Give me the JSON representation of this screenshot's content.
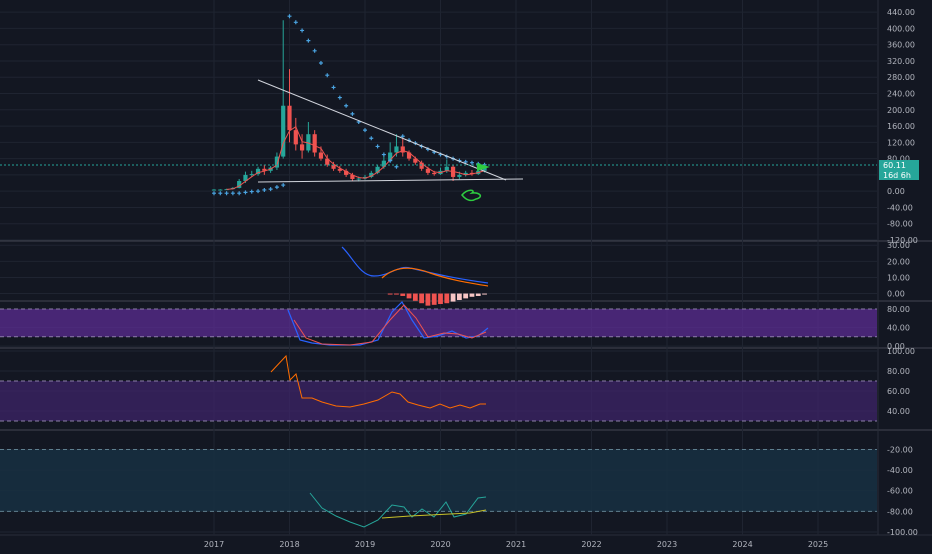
{
  "colors": {
    "bg": "#131722",
    "grid": "#1f2431",
    "axis_text": "#b2b5be",
    "up": "#26a69a",
    "down": "#ef5350",
    "sar": "#4aa3e0",
    "trend": "#d1d4dc",
    "last_badge": "#26a69a",
    "blue_line": "#2962ff",
    "orange_line": "#ff6d00",
    "band": "#4a2a7a",
    "wr_band": "#173042",
    "marker": "#2ecc40"
  },
  "x_axis": {
    "labels": [
      "2017",
      "2018",
      "2019",
      "2020",
      "2021",
      "2022",
      "2023",
      "2024",
      "2025"
    ]
  },
  "badges": {
    "last_price": "60.11",
    "countdown": "16d 6h"
  },
  "chart_data": [
    {
      "type": "candlestick",
      "pane": "price",
      "x": [
        "2017-01",
        "2017-02",
        "2017-03",
        "2017-04",
        "2017-05",
        "2017-06",
        "2017-07",
        "2017-08",
        "2017-09",
        "2017-10",
        "2017-11",
        "2017-12",
        "2018-01",
        "2018-02",
        "2018-03",
        "2018-04",
        "2018-05",
        "2018-06",
        "2018-07",
        "2018-08",
        "2018-09",
        "2018-10",
        "2018-11",
        "2018-12",
        "2019-01",
        "2019-02",
        "2019-03",
        "2019-04",
        "2019-05",
        "2019-06",
        "2019-07",
        "2019-08",
        "2019-09",
        "2019-10",
        "2019-11",
        "2019-12",
        "2020-01",
        "2020-02",
        "2020-03",
        "2020-04",
        "2020-05",
        "2020-06",
        "2020-07",
        "2020-08"
      ],
      "open": [
        4,
        4,
        4,
        5,
        8,
        25,
        40,
        42,
        55,
        50,
        58,
        85,
        210,
        150,
        115,
        100,
        140,
        95,
        80,
        65,
        55,
        50,
        40,
        30,
        31,
        35,
        45,
        60,
        75,
        95,
        110,
        95,
        80,
        70,
        55,
        45,
        42,
        50,
        60,
        35,
        40,
        45,
        42,
        50
      ],
      "close": [
        4,
        4,
        5,
        8,
        25,
        40,
        42,
        55,
        50,
        58,
        85,
        210,
        150,
        115,
        100,
        140,
        95,
        80,
        65,
        55,
        50,
        40,
        30,
        31,
        35,
        45,
        60,
        75,
        95,
        110,
        95,
        80,
        70,
        55,
        45,
        42,
        50,
        60,
        35,
        40,
        45,
        42,
        50,
        60
      ],
      "high": [
        5,
        5,
        6,
        10,
        30,
        48,
        50,
        60,
        65,
        62,
        95,
        420,
        300,
        180,
        140,
        170,
        150,
        110,
        90,
        72,
        62,
        55,
        45,
        36,
        40,
        50,
        65,
        90,
        120,
        140,
        130,
        100,
        85,
        75,
        60,
        50,
        58,
        78,
        65,
        48,
        50,
        52,
        56,
        66
      ],
      "low": [
        3,
        3,
        3,
        4,
        7,
        20,
        35,
        38,
        40,
        45,
        52,
        80,
        120,
        100,
        80,
        95,
        85,
        75,
        60,
        50,
        45,
        35,
        25,
        24,
        28,
        32,
        42,
        55,
        70,
        85,
        85,
        75,
        65,
        50,
        40,
        38,
        40,
        45,
        25,
        30,
        36,
        38,
        40,
        46
      ],
      "sar": [
        -5,
        -5,
        -5,
        -5,
        -5,
        -3,
        -1,
        0,
        3,
        5,
        10,
        15,
        430,
        415,
        395,
        370,
        345,
        315,
        285,
        255,
        230,
        210,
        190,
        170,
        150,
        130,
        110,
        90,
        75,
        60,
        135,
        125,
        118,
        110,
        103,
        96,
        90,
        85,
        80,
        75,
        72,
        70,
        67,
        65
      ],
      "ylim": [
        -120,
        460
      ],
      "y_ticks": [
        440,
        400,
        360,
        320,
        280,
        240,
        200,
        160,
        120,
        80,
        40,
        0,
        -40,
        -80,
        -120
      ]
    },
    {
      "type": "line+histogram",
      "pane": "macd",
      "x": [
        "2019-05",
        "2019-06",
        "2019-07",
        "2019-08",
        "2019-09",
        "2019-10",
        "2019-11",
        "2019-12",
        "2020-01",
        "2020-02",
        "2020-03",
        "2020-04",
        "2020-05",
        "2020-06",
        "2020-07",
        "2020-08"
      ],
      "histogram": [
        0,
        0,
        -1.5,
        -3,
        -4.5,
        -6,
        -7.5,
        -7,
        -6.5,
        -6,
        -5,
        -4,
        -3,
        -2,
        -1.5,
        -0.5
      ],
      "ylim": [
        -4,
        32
      ],
      "y_ticks": [
        30,
        20,
        10,
        0
      ]
    },
    {
      "type": "line",
      "pane": "stochastic",
      "ylim": [
        -2,
        95
      ],
      "y_ticks": [
        80,
        40,
        0
      ],
      "band": [
        20,
        80
      ]
    },
    {
      "type": "line",
      "pane": "rsi",
      "ylim": [
        22,
        102
      ],
      "y_ticks": [
        100,
        80,
        60,
        40
      ],
      "band": [
        30,
        70
      ]
    },
    {
      "type": "line",
      "pane": "williams_r",
      "ylim": [
        -102,
        -2
      ],
      "y_ticks": [
        -20,
        -40,
        -60,
        -80,
        -100
      ],
      "band": [
        -80,
        -20
      ]
    }
  ]
}
